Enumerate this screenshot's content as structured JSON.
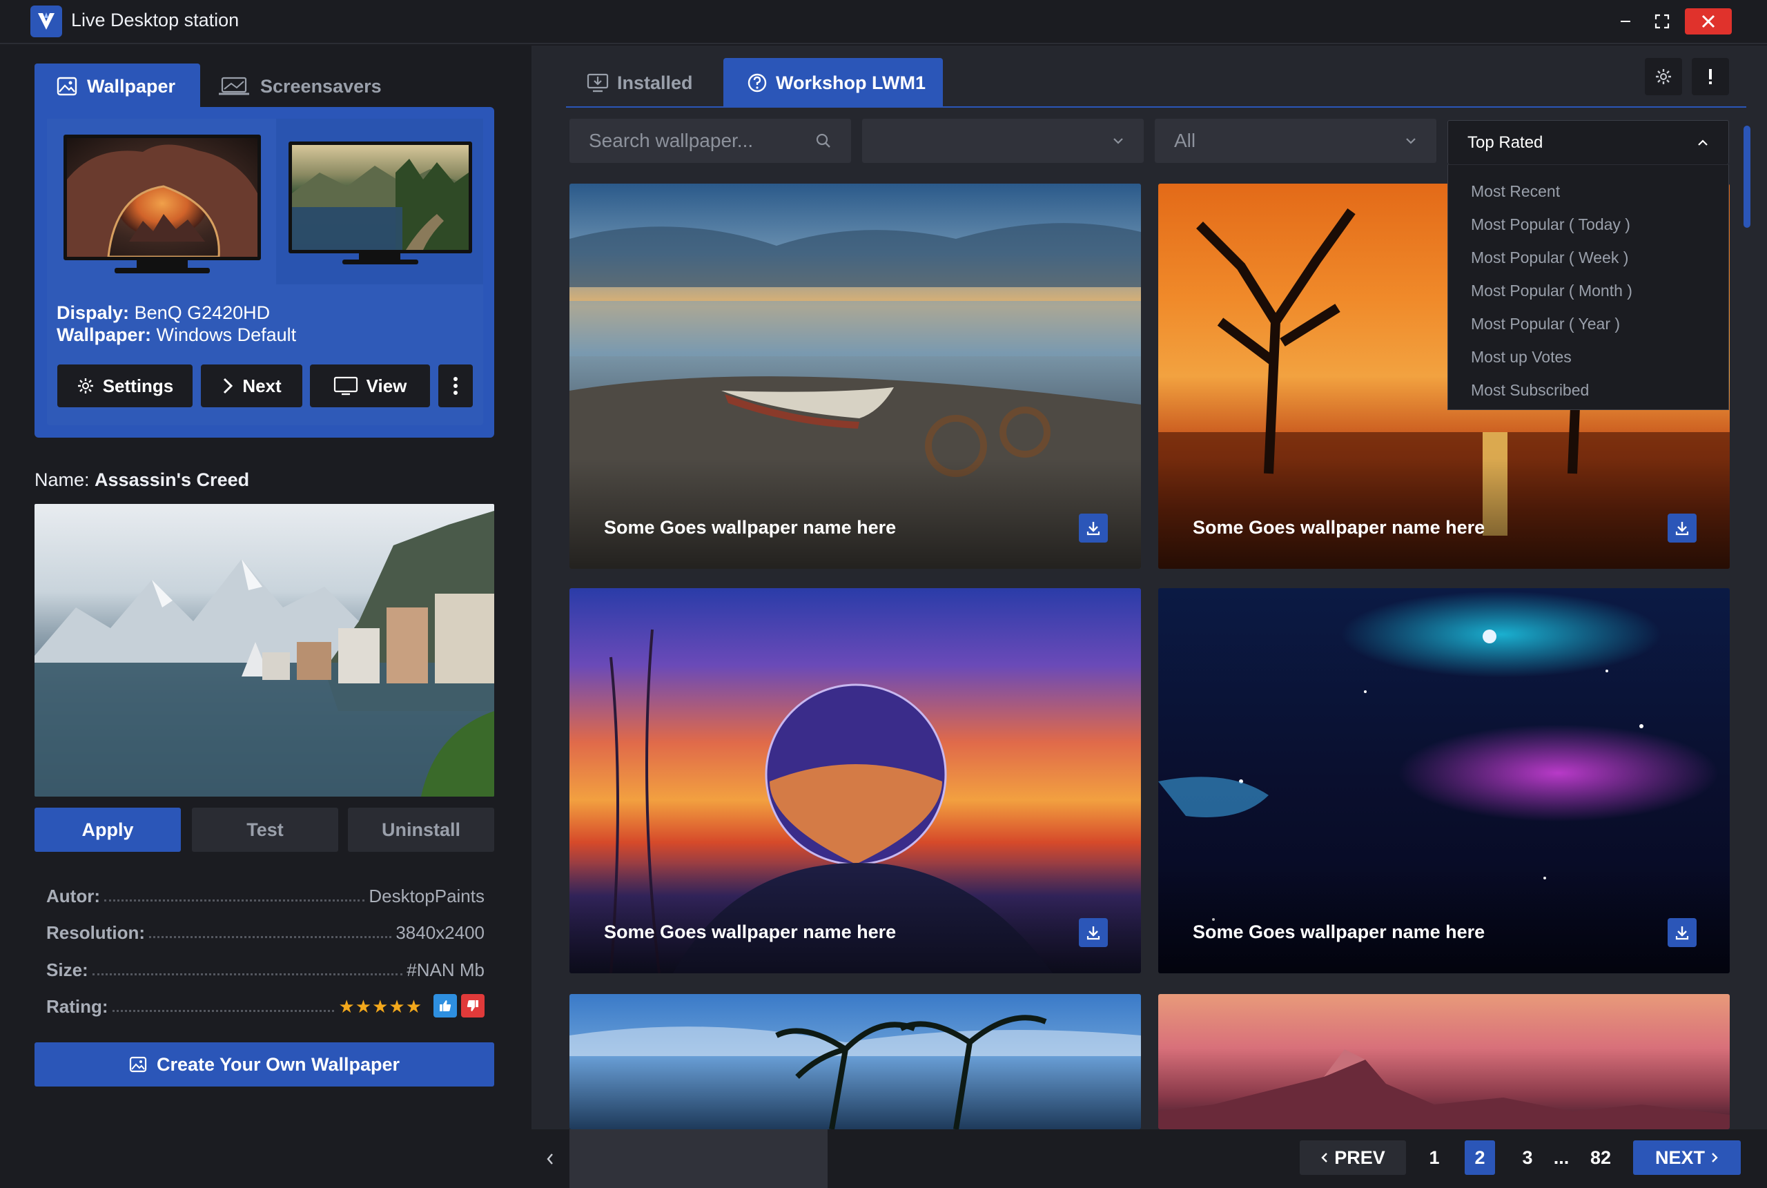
{
  "window": {
    "title": "Live Desktop station"
  },
  "left": {
    "tabs": [
      {
        "label": "Wallpaper",
        "icon": "image-icon",
        "active": true
      },
      {
        "label": "Screensavers",
        "icon": "laptop-icon",
        "active": false
      }
    ],
    "display": {
      "display_label": "Dispaly:",
      "display_value": "BenQ G2420HD",
      "wallpaper_label": "Wallpaper:",
      "wallpaper_value": "Windows Default"
    },
    "panel_buttons": {
      "settings": "Settings",
      "next": "Next",
      "view": "View"
    },
    "name_label": "Name:",
    "name_value": "Assassin's Creed",
    "actions": {
      "apply": "Apply",
      "test": "Test",
      "uninstall": "Uninstall"
    },
    "meta": {
      "author_label": "Autor:",
      "author_value": "DesktopPaints",
      "resolution_label": "Resolution:",
      "resolution_value": "3840x2400",
      "size_label": "Size:",
      "size_value": "#NAN Mb",
      "rating_label": "Rating:",
      "rating_stars": 5,
      "rating_display": "★★★★★"
    },
    "create_label": "Create Your Own Wallpaper"
  },
  "right": {
    "tabs": [
      {
        "label": "Installed",
        "icon": "monitor-download-icon",
        "active": false
      },
      {
        "label": "Workshop LWM1",
        "icon": "help-circle-icon",
        "active": true
      }
    ],
    "search": {
      "placeholder": "Search wallpaper..."
    },
    "filters": {
      "one_value": "",
      "two_value": "All"
    },
    "sort": {
      "selected": "Top Rated",
      "options": [
        "Most Recent",
        "Most Popular ( Today )",
        "Most Popular ( Week )",
        "Most Popular ( Month )",
        "Most Popular ( Year )",
        "Most up Votes",
        "Most Subscribed"
      ]
    },
    "cards": [
      {
        "title": "Some Goes wallpaper name here"
      },
      {
        "title": "Some Goes wallpaper name here"
      },
      {
        "title": "Some Goes wallpaper name here"
      },
      {
        "title": "Some Goes wallpaper name here"
      }
    ],
    "pagination": {
      "prev": "PREV",
      "pages": [
        "1",
        "2",
        "3"
      ],
      "ellipsis": "...",
      "last": "82",
      "current": "2",
      "next": "NEXT"
    }
  },
  "colors": {
    "accent": "#2b56b8",
    "background": "#1b1c21",
    "panel": "#25272e",
    "close": "#e0322c",
    "star": "#f3a81c",
    "vote_up": "#2e8fe0",
    "vote_down": "#e03a3a"
  }
}
